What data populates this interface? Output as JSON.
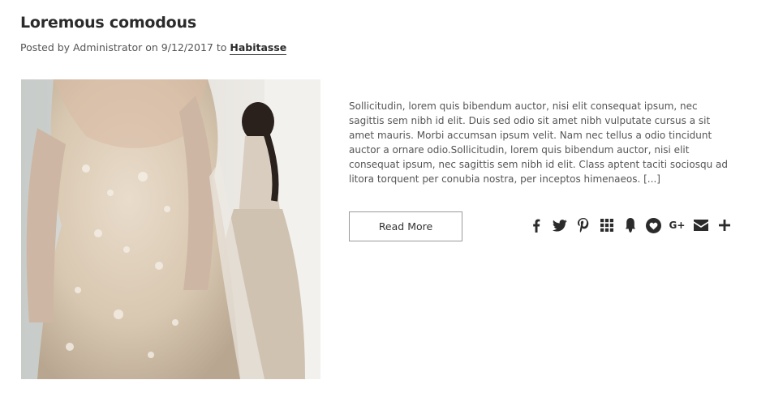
{
  "post": {
    "title": "Loremous comodous",
    "meta_prefix": "Posted by Administrator on 9/12/2017 to",
    "category": "Habitasse",
    "excerpt": "Sollicitudin, lorem quis bibendum auctor, nisi elit consequat ipsum, nec sagittis sem nibh id elit. Duis sed odio sit amet nibh vulputate cursus a sit amet mauris. Morbi accumsan ipsum velit. Nam nec tellus a odio tincidunt auctor a ornare odio.Sollicitudin, lorem quis bibendum auctor, nisi elit consequat ipsum, nec sagittis sem nibh id elit. Class aptent taciti sociosqu ad litora torquent per conubia nostra, per inceptos himenaeos. [...]",
    "read_more_label": "Read More",
    "image_icon": "wedding-dress-photo"
  },
  "share": {
    "icons": [
      "facebook-icon",
      "twitter-icon",
      "pinterest-icon",
      "grid-icon",
      "blogger-icon",
      "heart-icon",
      "google-plus-icon",
      "email-icon",
      "plus-icon"
    ],
    "google_plus_label": "G+",
    "icon_color": "#2b2b2b"
  }
}
